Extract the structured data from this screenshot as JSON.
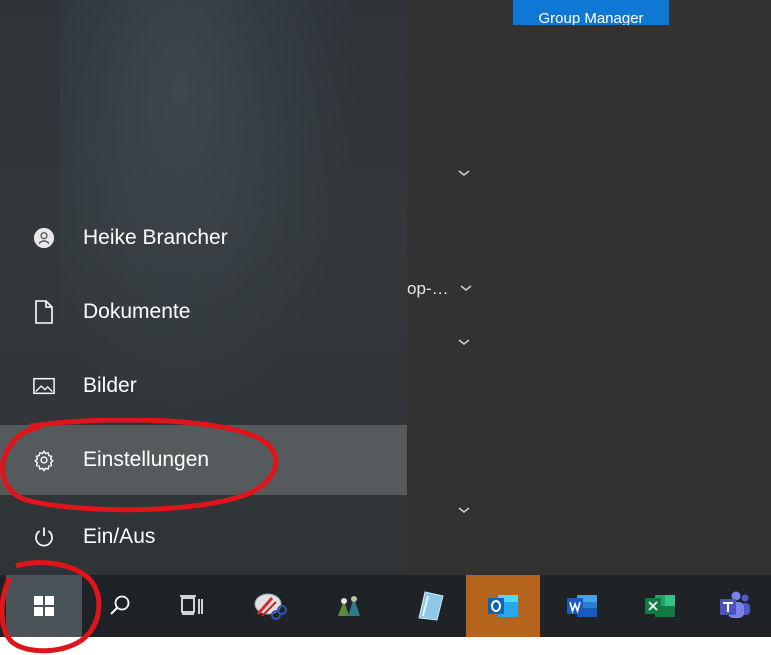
{
  "tiles": {
    "group_tile_label": "Group Manager",
    "truncated_label": "op-…"
  },
  "menu": {
    "user_name": "Heike Brancher",
    "documents": "Dokumente",
    "pictures": "Bilder",
    "settings": "Einstellungen",
    "power": "Ein/Aus"
  },
  "taskbar": {
    "apps": [
      "search",
      "task-view",
      "snipping-tool",
      "people-app",
      "notes-app",
      "outlook",
      "word",
      "excel",
      "teams"
    ]
  },
  "colors": {
    "accent_blue": "#0f78d4",
    "annotation_red": "#e0141a",
    "outlook_active": "#b5641e"
  }
}
